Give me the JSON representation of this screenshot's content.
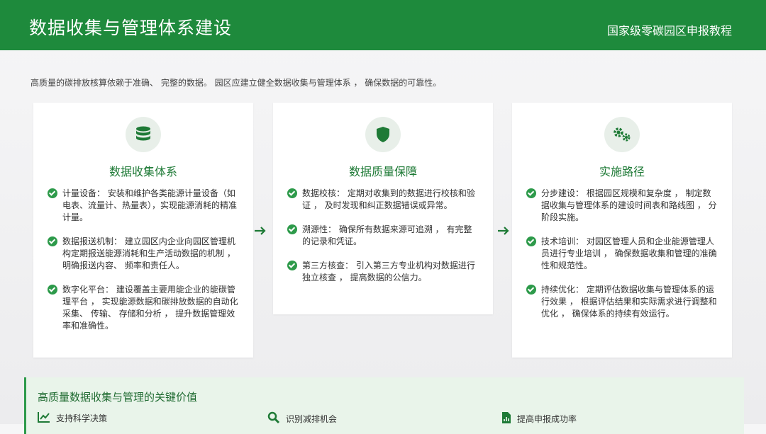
{
  "header": {
    "title": "数据收集与管理体系建设",
    "subtitle": "国家级零碳园区申报教程"
  },
  "intro": "高质量的碳排放核算依赖于准确、 完整的数据。 园区应建立健全数据收集与管理体系 ， 确保数据的可靠性。",
  "cards": [
    {
      "icon": "database-icon",
      "title": "数据收集体系",
      "items": [
        "计量设备：  安装和维护各类能源计量设备（如电表、流量计、热量表），实现能源消耗的精准计量。",
        "数据报送机制： 建立园区内企业向园区管理机构定期报送能源消耗和生产活动数据的机制 ， 明确报送内容、 频率和责任人。",
        "数字化平台： 建设覆盖主要用能企业的能碳管理平台 ， 实现能源数据和碳排放数据的自动化采集、 传输、 存储和分析 ， 提升数据管理效率和准确性。"
      ]
    },
    {
      "icon": "shield-icon",
      "title": "数据质量保障",
      "items": [
        "数据校核： 定期对收集到的数据进行校核和验证 ， 及时发现和纠正数据错误或异常。",
        "溯源性： 确保所有数据来源可追溯 ， 有完整的记录和凭证。",
        "第三方核查：  引入第三方专业机构对数据进行独立核查 ， 提高数据的公信力。"
      ]
    },
    {
      "icon": "gears-icon",
      "title": "实施路径",
      "items": [
        "分步建设： 根据园区规模和复杂度 ， 制定数据收集与管理体系的建设时间表和路线图 ， 分阶段实施。",
        "技术培训： 对园区管理人员和企业能源管理人员进行专业培训 ， 确保数据收集和管理的准确性和规范性。",
        "持续优化： 定期评估数据收集与管理体系的运行效果 ， 根据评估结果和实际需求进行调整和优化 ， 确保体系的持续有效运行。"
      ]
    }
  ],
  "value": {
    "title": "高质量数据收集与管理的关键价值",
    "items": [
      {
        "icon": "chart-line-icon",
        "label": "支持科学决策"
      },
      {
        "icon": "search-icon",
        "label": "识别减排机会"
      },
      {
        "icon": "file-chart-icon",
        "label": "提高申报成功率"
      }
    ]
  },
  "colors": {
    "brand": "#1e8a3c",
    "accent": "#2d9a4a",
    "light": "#e9f4ea"
  }
}
